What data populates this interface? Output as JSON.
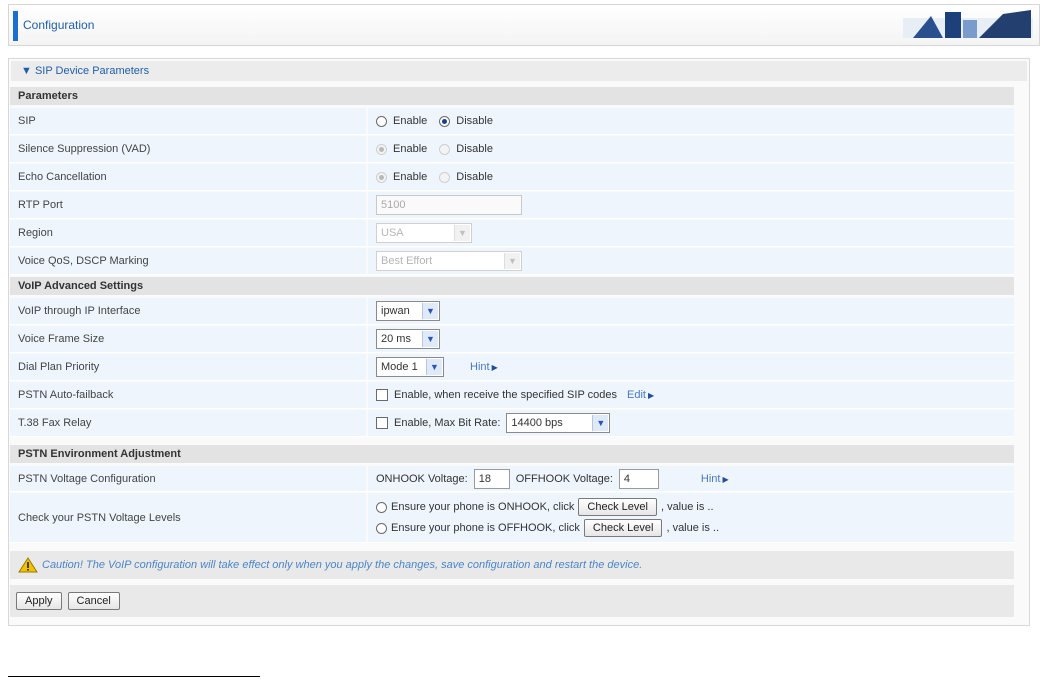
{
  "header": {
    "title": "Configuration"
  },
  "section": {
    "toggle": "▼ SIP Device Parameters"
  },
  "groups": {
    "parameters": "Parameters",
    "voip_advanced": "VoIP Advanced Settings",
    "pstn_env": "PSTN Environment Adjustment"
  },
  "radio_labels": {
    "enable": "Enable",
    "disable": "Disable"
  },
  "rows": {
    "sip": {
      "label": "SIP",
      "selected": "Disable"
    },
    "vad": {
      "label": "Silence Suppression (VAD)",
      "selected": "Enable"
    },
    "echo": {
      "label": "Echo Cancellation",
      "selected": "Enable"
    },
    "rtp": {
      "label": "RTP Port",
      "value": "5100"
    },
    "region": {
      "label": "Region",
      "value": "USA"
    },
    "qos": {
      "label": "Voice QoS, DSCP Marking",
      "value": "Best Effort"
    },
    "ip_iface": {
      "label": "VoIP through IP Interface",
      "value": "ipwan"
    },
    "frame": {
      "label": "Voice Frame Size",
      "value": "20 ms"
    },
    "dial": {
      "label": "Dial Plan Priority",
      "value": "Mode 1",
      "hint": "Hint"
    },
    "pstn_fallback": {
      "label": "PSTN Auto-failback",
      "check_text": "Enable, when receive the specified SIP codes",
      "edit": "Edit"
    },
    "t38": {
      "label": "T.38 Fax Relay",
      "check_text": "Enable, Max Bit Rate:",
      "value": "14400 bps"
    },
    "pstn_voltage": {
      "label": "PSTN Voltage Configuration",
      "onhook_label": "ONHOOK Voltage:",
      "onhook_value": "18",
      "offhook_label": "OFFHOOK Voltage:",
      "offhook_value": "4",
      "hint": "Hint"
    },
    "check_levels": {
      "label": "Check your PSTN Voltage Levels",
      "line1": "Ensure your phone is ONHOOK, click",
      "line2": "Ensure your phone is OFFHOOK, click",
      "button": "Check Level",
      "suffix1": ", value is ..",
      "suffix2": ", value is .."
    }
  },
  "caution": "Caution! The VoIP configuration will take effect only when you apply the changes, save configuration and restart the device.",
  "buttons": {
    "apply": "Apply",
    "cancel": "Cancel"
  }
}
